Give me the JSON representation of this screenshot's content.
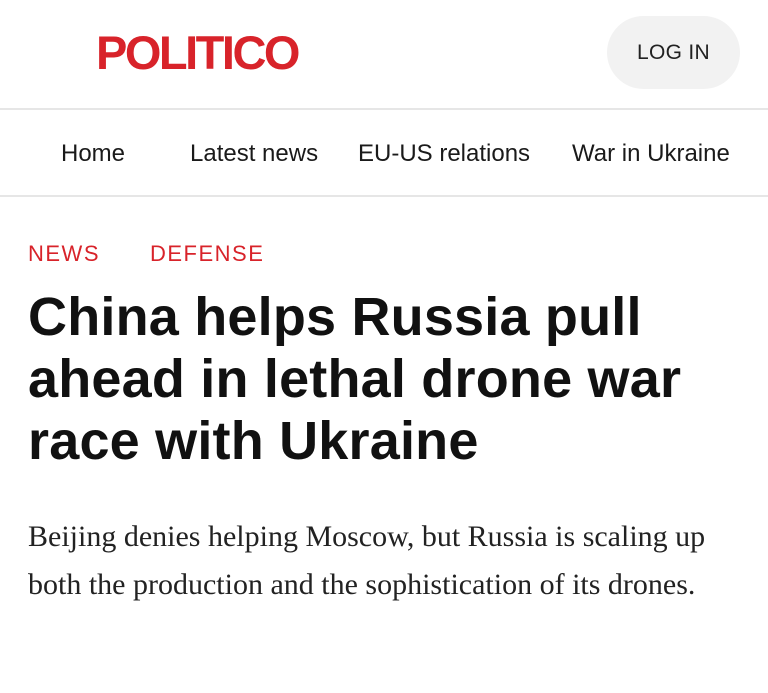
{
  "header": {
    "logo_text": "POLITICO",
    "login_label": "LOG IN"
  },
  "nav": {
    "items": [
      {
        "label": "Home"
      },
      {
        "label": "Latest news"
      },
      {
        "label": "EU-US relations"
      },
      {
        "label": "War in Ukraine"
      }
    ]
  },
  "article": {
    "tags": [
      {
        "label": "NEWS"
      },
      {
        "label": "DEFENSE"
      }
    ],
    "headline": "China helps Russia pull ahead in lethal drone war race with Ukraine",
    "dek": "Beijing denies helping Moscow, but Russia is scaling up both the production and the sophistication of its drones."
  },
  "colors": {
    "brand_red": "#d8232a",
    "login_bg": "#f2f2f2",
    "divider": "#e6e6e6"
  }
}
